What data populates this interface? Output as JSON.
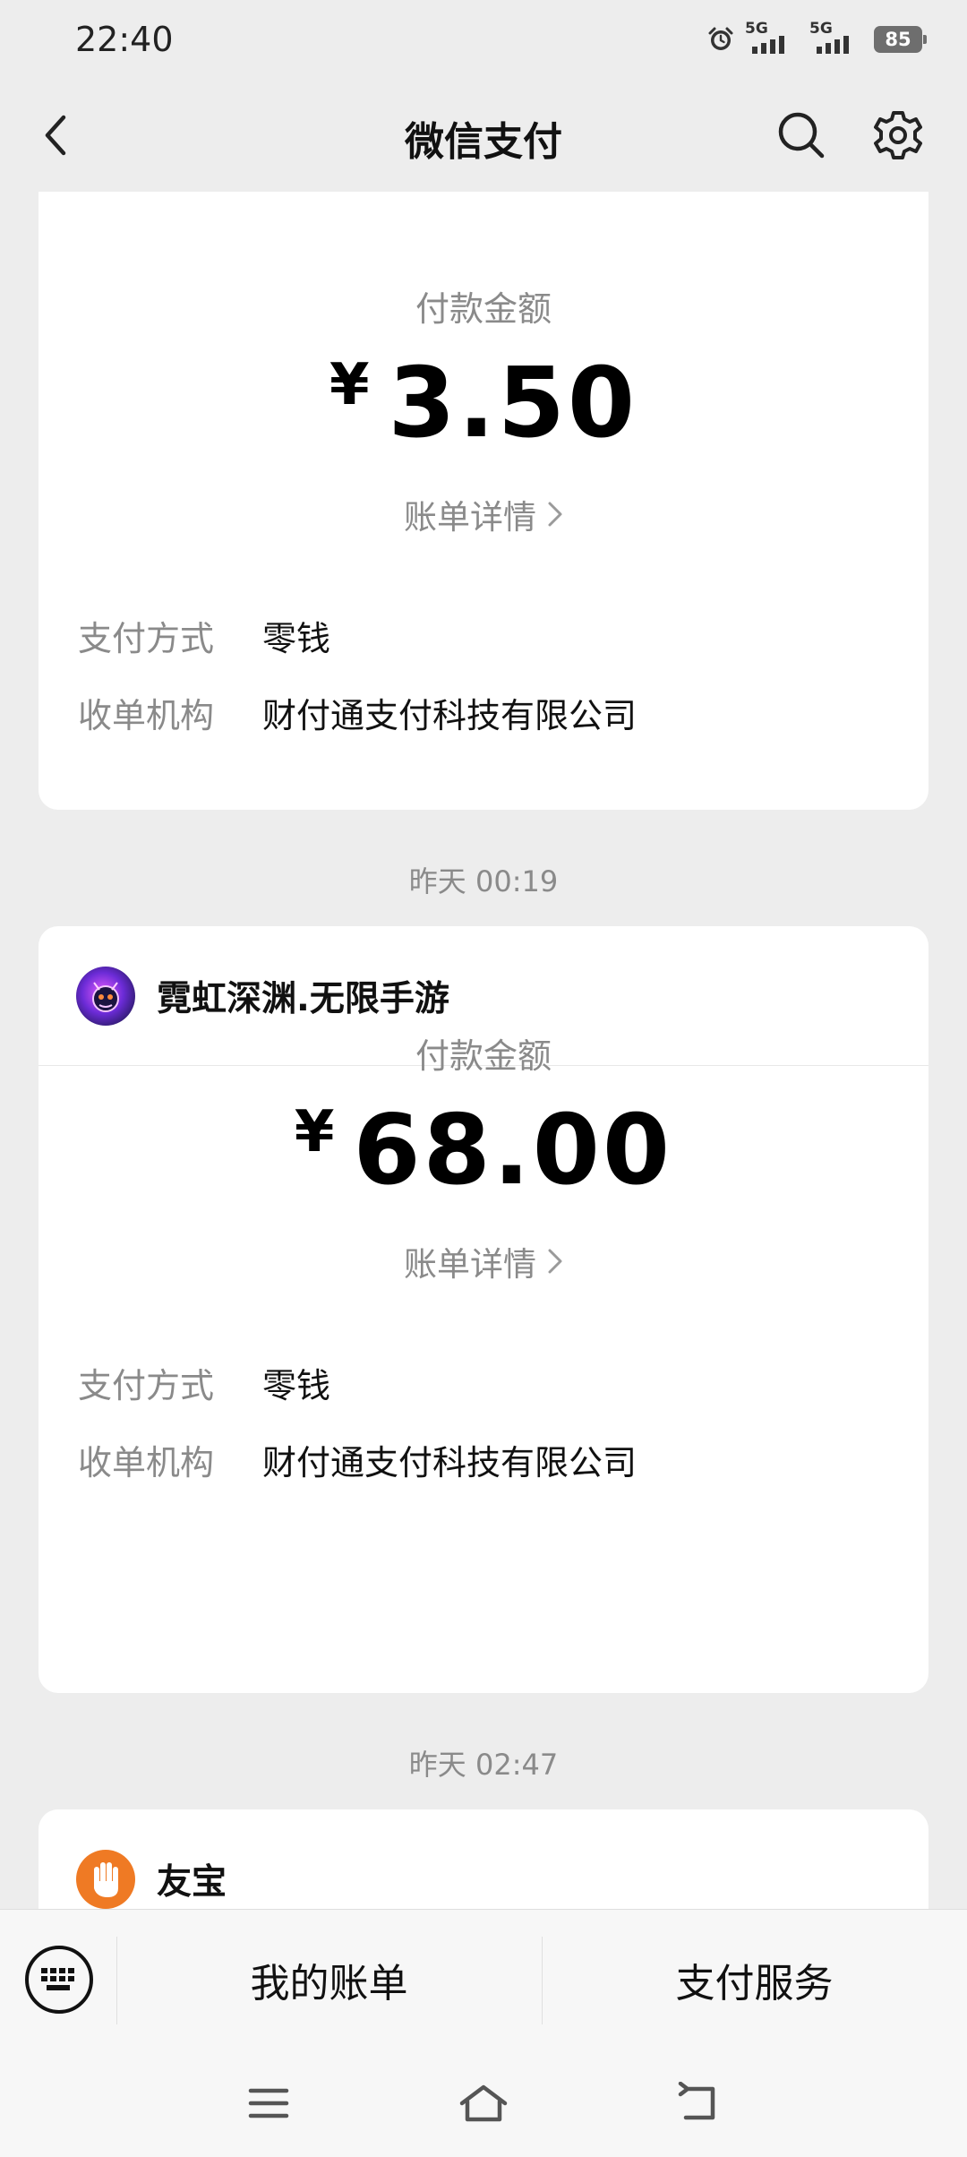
{
  "status_bar": {
    "time": "22:40",
    "signal_1": "5G",
    "signal_2": "5G",
    "battery": "85"
  },
  "nav": {
    "title": "微信支付"
  },
  "cards": [
    {
      "amount_label": "付款金额",
      "currency": "¥",
      "amount": "3.50",
      "detail_link": "账单详情",
      "pay_method_key": "支付方式",
      "pay_method_val": "零钱",
      "acquirer_key": "收单机构",
      "acquirer_val": "财付通支付科技有限公司"
    },
    {
      "timestamp": "昨天 00:19",
      "merchant": "霓虹深渊.无限手游",
      "amount_label": "付款金额",
      "currency": "¥",
      "amount": "68.00",
      "detail_link": "账单详情",
      "pay_method_key": "支付方式",
      "pay_method_val": "零钱",
      "acquirer_key": "收单机构",
      "acquirer_val": "财付通支付科技有限公司"
    },
    {
      "timestamp": "昨天 02:47",
      "merchant": "友宝"
    }
  ],
  "bottom_bar": {
    "my_bill": "我的账单",
    "pay_service": "支付服务"
  },
  "colors": {
    "background": "#ededed",
    "card": "#ffffff",
    "muted_text": "#8a8a8a",
    "youbao_orange": "#ef7a24"
  },
  "icons": [
    "back-icon",
    "search-icon",
    "gear-icon",
    "keyboard-icon",
    "menu-icon",
    "home-icon",
    "back-gesture-icon",
    "alarm-icon",
    "chevron-right-icon"
  ]
}
